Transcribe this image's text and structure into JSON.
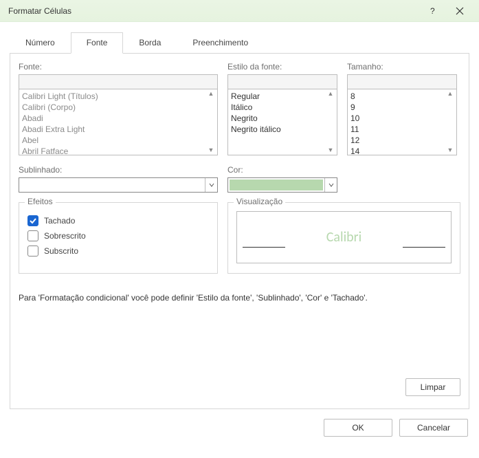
{
  "title": "Formatar Células",
  "tabs": {
    "number": "Número",
    "font": "Fonte",
    "border": "Borda",
    "fill": "Preenchimento"
  },
  "labels": {
    "font": "Fonte:",
    "style": "Estilo da fonte:",
    "size": "Tamanho:",
    "underline": "Sublinhado:",
    "color": "Cor:",
    "effects": "Efeitos",
    "preview": "Visualização"
  },
  "fontList": [
    "Calibri Light (Títulos)",
    "Calibri (Corpo)",
    "Abadi",
    "Abadi Extra Light",
    "Abel",
    "Abril Fatface"
  ],
  "styleList": [
    "Regular",
    "Itálico",
    "Negrito",
    "Negrito itálico"
  ],
  "sizeList": [
    "8",
    "9",
    "10",
    "11",
    "12",
    "14"
  ],
  "effects": {
    "strike": "Tachado",
    "superscript": "Sobrescrito",
    "subscript": "Subscrito"
  },
  "previewFont": "Calibri",
  "note": "Para 'Formatação condicional' você pode definir 'Estilo da fonte', 'Sublinhado', 'Cor' e 'Tachado'.",
  "buttons": {
    "clear": "Limpar",
    "ok": "OK",
    "cancel": "Cancelar"
  },
  "colors": {
    "accent": "#b7d8ae"
  }
}
